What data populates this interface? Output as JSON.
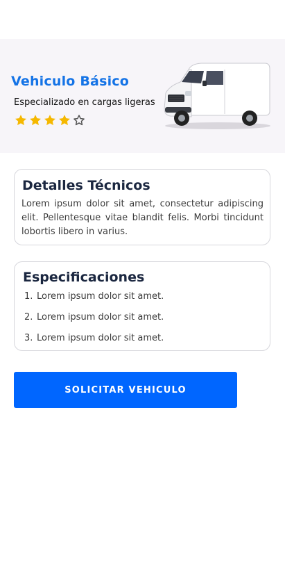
{
  "vehicle": {
    "title": "Vehiculo Básico",
    "subtitle": "Especializado en cargas ligeras",
    "rating": 4,
    "rating_max": 5,
    "image": "white-cargo-van-image",
    "colors": {
      "title": "#1473e6",
      "star_filled": "#f5b800",
      "hero_background": "#f7f5f9"
    }
  },
  "details_card": {
    "title": "Detalles Técnicos",
    "body": "Lorem ipsum dolor sit amet, consectetur adipiscing elit. Pellentesque vitae blandit felis. Morbi tincidunt lobortis libero in varius."
  },
  "specs_card": {
    "title": "Especificaciones",
    "items": [
      {
        "number": "1.",
        "text": "Lorem ipsum dolor sit amet."
      },
      {
        "number": "2.",
        "text": "Lorem ipsum dolor sit amet."
      },
      {
        "number": "3.",
        "text": "Lorem ipsum dolor sit amet."
      }
    ]
  },
  "cta": {
    "label": "SOLICITAR VEHICULO",
    "color": "#0066ff"
  }
}
